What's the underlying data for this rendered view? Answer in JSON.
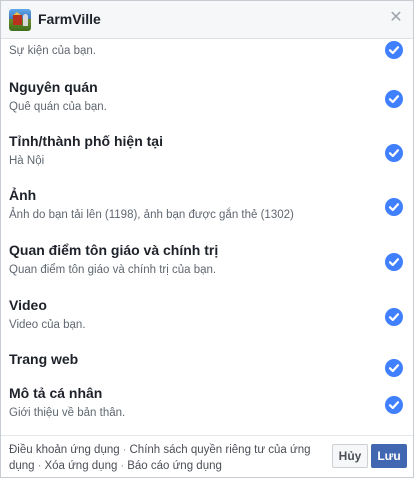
{
  "header": {
    "app_name": "FarmVille",
    "close_symbol": "✕"
  },
  "permissions": [
    {
      "title": "",
      "description": "Sự kiện của bạn.",
      "checked": true
    },
    {
      "title": "Nguyên quán",
      "description": "Quê quán của bạn.",
      "checked": true
    },
    {
      "title": "Tỉnh/thành phố hiện tại",
      "description": "Hà Nội",
      "checked": true
    },
    {
      "title": "Ảnh",
      "description": "Ảnh do bạn tải lên (1198), ảnh bạn được gắn thẻ (1302)",
      "checked": true
    },
    {
      "title": "Quan điểm tôn giáo và chính trị",
      "description": "Quan điểm tôn giáo và chính trị của bạn.",
      "checked": true
    },
    {
      "title": "Video",
      "description": "Video của bạn.",
      "checked": true
    },
    {
      "title": "Trang web",
      "description": "",
      "checked": true
    },
    {
      "title": "Mô tả cá nhân",
      "description": "Giới thiệu về bản thân.",
      "checked": true
    }
  ],
  "footer": {
    "links": [
      "Điều khoản ứng dụng",
      "Chính sách quyền riêng tư của ứng dụng",
      "Xóa ứng dụng",
      "Báo cáo ứng dụng"
    ],
    "separator": "·",
    "cancel_label": "Hủy",
    "save_label": "Lưu"
  },
  "colors": {
    "check": "#4080ff",
    "save_button": "#4267b2"
  },
  "icons": {
    "app": "farmville-app-icon",
    "close": "close-icon",
    "check": "check-circle-icon"
  }
}
